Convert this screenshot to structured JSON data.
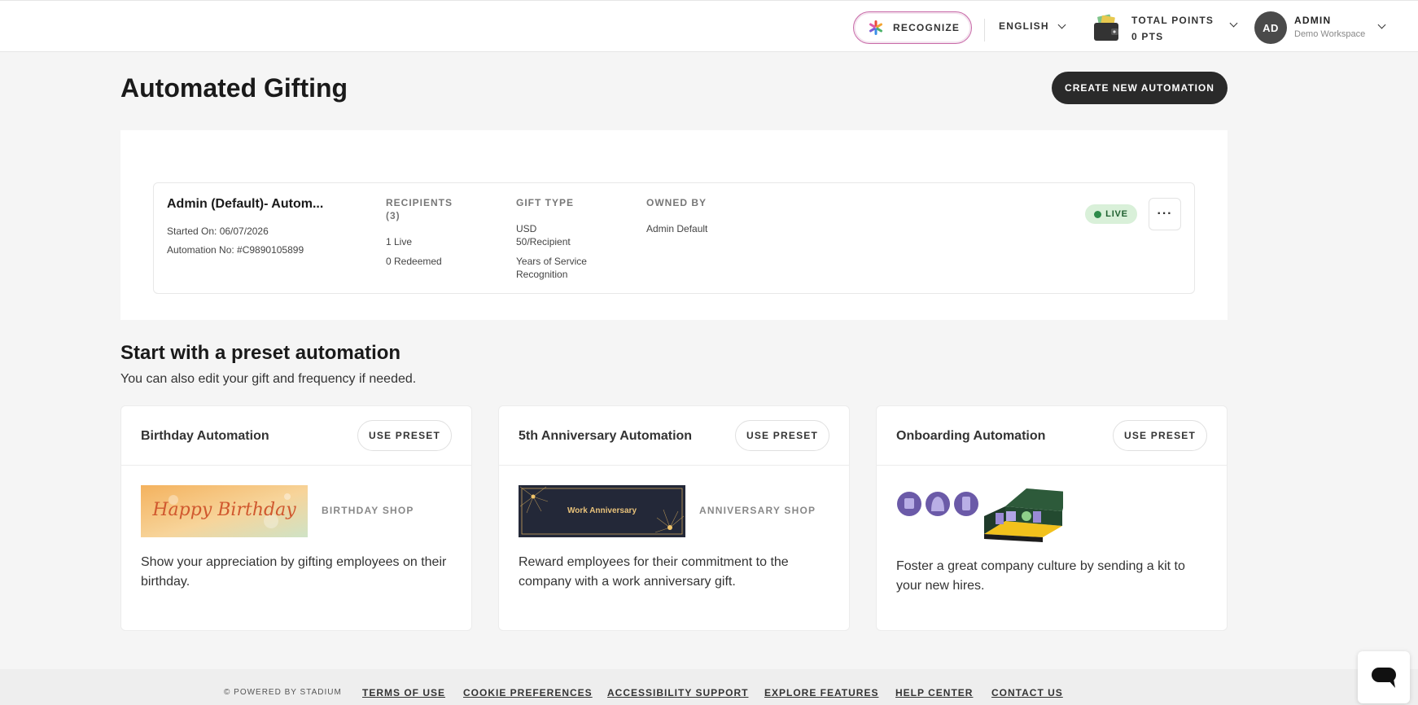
{
  "header": {
    "recognize_label": "RECOGNIZE",
    "language": "ENGLISH",
    "points_label": "TOTAL POINTS",
    "points_value": "0 PTS",
    "avatar_initials": "AD",
    "user_name": "ADMIN",
    "workspace": "Demo Workspace"
  },
  "page": {
    "title": "Automated Gifting",
    "create_button": "CREATE NEW AUTOMATION"
  },
  "automation": {
    "name": "Admin (Default)- Autom...",
    "started_on": "Started On: 06/07/2026",
    "automation_no": "Automation No: #C9890105899",
    "recipients_header": "RECIPIENTS",
    "recipients_count": "(3)",
    "live_count": "1 Live",
    "redeemed_count": "0 Redeemed",
    "gift_type_header": "GIFT TYPE",
    "gift_currency": "USD",
    "gift_amount": "50/Recipient",
    "gift_occasion_1": "Years of Service",
    "gift_occasion_2": "Recognition",
    "owned_by_header": "OWNED BY",
    "owner": "Admin Default",
    "status": "LIVE",
    "more": "···"
  },
  "presets": {
    "title": "Start with a preset automation",
    "subtitle": "You can also edit your gift and frequency if needed.",
    "use_preset_label": "USE PRESET",
    "cards": [
      {
        "title": "Birthday Automation",
        "image_text": "Happy Birthday",
        "shop": "BIRTHDAY SHOP",
        "description": "Show your appreciation by gifting employees on their birthday."
      },
      {
        "title": "5th Anniversary Automation",
        "image_text": "Work Anniversary",
        "shop": "ANNIVERSARY SHOP",
        "description": "Reward employees for their commitment to the company with a work anniversary gift."
      },
      {
        "title": "Onboarding Automation",
        "shop": "",
        "description": "Foster a great company culture by sending a kit to your new hires."
      }
    ]
  },
  "footer": {
    "powered": "© POWERED BY STADIUM",
    "links": [
      "TERMS OF USE",
      "COOKIE PREFERENCES",
      "ACCESSIBILITY SUPPORT",
      "EXPLORE FEATURES",
      "HELP CENTER",
      "CONTACT US"
    ]
  },
  "colors": {
    "accent_dark": "#2a2a2a",
    "live_bg": "#d9f0d9",
    "live_dot": "#2e8b4a",
    "recognize_border": "#c86aa8"
  }
}
